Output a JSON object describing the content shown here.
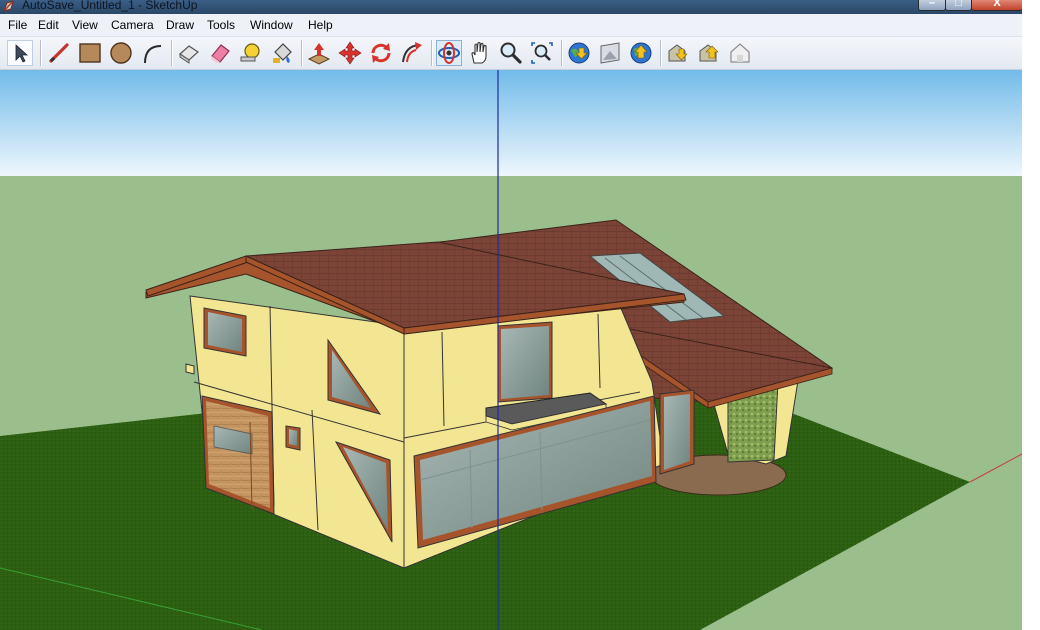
{
  "window": {
    "title": "AutoSave_Untitled_1 - SketchUp",
    "controls": {
      "minimize": "–",
      "maximize": "□",
      "close": "X"
    }
  },
  "menu": [
    "File",
    "Edit",
    "View",
    "Camera",
    "Draw",
    "Tools",
    "Window",
    "Help"
  ],
  "toolbar": {
    "tools": [
      "select",
      "line",
      "rectangle",
      "circle",
      "arc",
      "make-component",
      "eraser",
      "tape-measure",
      "paint-bucket",
      "push-pull",
      "move",
      "rotate",
      "follow-me",
      "orbit",
      "pan",
      "zoom",
      "zoom-extents",
      "get-models",
      "share-model",
      "add-location",
      "get-photo-texture",
      "preview-in-google-earth",
      "share-component"
    ],
    "active_tool": "orbit"
  },
  "colors": {
    "sky": "#79c1ec",
    "ground": "#9bbf8c",
    "lawn": "#2e6014",
    "wall": "#f3e692",
    "roof": "#7b4437",
    "trim": "#a5542c",
    "axis_blue": "#1f2c9e",
    "axis_green": "#35a032",
    "axis_red": "#c24040"
  },
  "scene": {
    "model": "two-storey house",
    "axes_visible": true
  }
}
